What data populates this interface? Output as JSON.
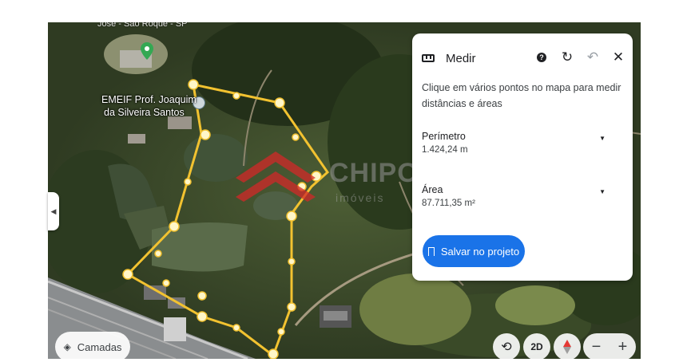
{
  "map": {
    "top_label": "José - São Roque - SP",
    "school_label_line1": "EMEIF Prof. Joaquim",
    "school_label_line2": "da Silveira Santos"
  },
  "watermark": {
    "text": "CHIPOLI",
    "subtitle": "imóveis"
  },
  "panel": {
    "title": "Medir",
    "instructions": "Clique em vários pontos no mapa para medir distâncias e áreas",
    "perimeter_label": "Perímetro",
    "perimeter_value": "1.424,24 m",
    "area_label": "Área",
    "area_value": "87.711,35 m²",
    "save_button": "Salvar no projeto"
  },
  "controls": {
    "layers_label": "Camadas",
    "view_mode": "2D",
    "zoom_out": "−",
    "zoom_in": "+"
  },
  "colors": {
    "accent": "#1a73e8",
    "measure_line": "#f2c230"
  },
  "icons": [
    "ruler-icon",
    "help-icon",
    "refresh-icon",
    "undo-icon",
    "close-icon",
    "layers-icon",
    "rotate-icon",
    "compass-icon",
    "bookmark-icon",
    "location-pin-icon"
  ]
}
